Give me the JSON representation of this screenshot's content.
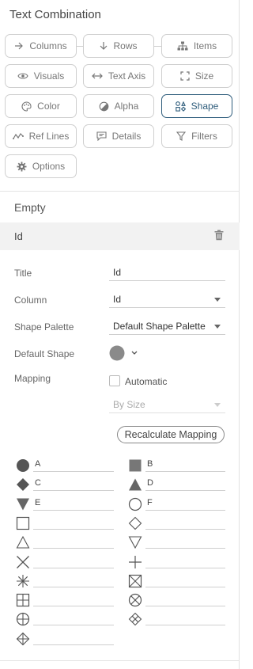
{
  "panel": {
    "title": "Text Combination"
  },
  "buttons": {
    "columns": "Columns",
    "rows": "Rows",
    "items": "Items",
    "visuals": "Visuals",
    "text_axis": "Text Axis",
    "size": "Size",
    "color": "Color",
    "alpha": "Alpha",
    "shape": "Shape",
    "ref_lines": "Ref Lines",
    "details": "Details",
    "filters": "Filters",
    "options": "Options"
  },
  "section": {
    "empty_label": "Empty",
    "item_label": "Id"
  },
  "props": {
    "title_label": "Title",
    "title_value": "Id",
    "column_label": "Column",
    "column_value": "Id",
    "palette_label": "Shape Palette",
    "palette_value": "Default Shape Palette",
    "default_shape_label": "Default Shape",
    "mapping_label": "Mapping",
    "automatic_label": "Automatic",
    "by_size_value": "By Size",
    "recalc_label": "Recalculate Mapping"
  },
  "mappings": [
    {
      "shape": "circle-filled",
      "value": "A"
    },
    {
      "shape": "square-filled",
      "value": "B"
    },
    {
      "shape": "diamond-filled",
      "value": "C"
    },
    {
      "shape": "triangle-up-filled",
      "value": "D"
    },
    {
      "shape": "triangle-down-filled",
      "value": "E"
    },
    {
      "shape": "circle-outline",
      "value": "F"
    },
    {
      "shape": "square-outline",
      "value": ""
    },
    {
      "shape": "diamond-outline",
      "value": ""
    },
    {
      "shape": "triangle-up-outline",
      "value": ""
    },
    {
      "shape": "triangle-down-outline",
      "value": ""
    },
    {
      "shape": "x-cross",
      "value": ""
    },
    {
      "shape": "plus",
      "value": ""
    },
    {
      "shape": "asterisk",
      "value": ""
    },
    {
      "shape": "square-x",
      "value": ""
    },
    {
      "shape": "square-plus",
      "value": ""
    },
    {
      "shape": "circle-x",
      "value": ""
    },
    {
      "shape": "circle-plus",
      "value": ""
    },
    {
      "shape": "diamond-x",
      "value": ""
    },
    {
      "shape": "diamond-plus",
      "value": ""
    }
  ],
  "colors": {
    "active": "#2f5d7c",
    "shape": "#555555",
    "border": "#cfcfcf"
  }
}
